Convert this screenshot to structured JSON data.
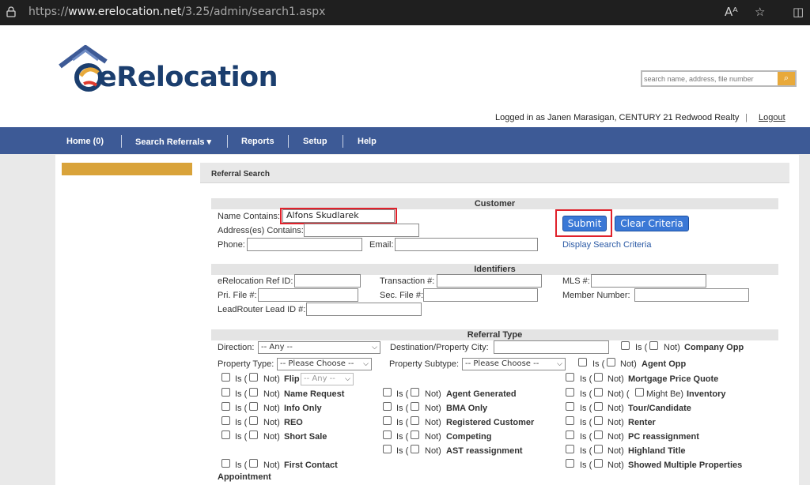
{
  "browser": {
    "url_scheme": "https://",
    "url_host": "www.erelocation.net",
    "url_path": "/3.25/admin/search1.aspx",
    "read_aloud_icon": "Aᴬ",
    "favorite_icon": "☆",
    "split_icon": "◫"
  },
  "header": {
    "logo_text": "eRelocation",
    "search_placeholder": "search name, address, file number",
    "logged_in_text": "Logged in as Janen Marasigan, CENTURY 21 Redwood Realty",
    "separator": "|",
    "logout_label": "Logout"
  },
  "nav": {
    "items": [
      "Home (0)",
      "Search Referrals ▾",
      "Reports",
      "Setup",
      "Help"
    ]
  },
  "page": {
    "section_title": "Referral Search",
    "customer": {
      "group_title": "Customer",
      "name_label": "Name Contains:",
      "name_value": "Alfons Skudlarek",
      "address_label": "Address(es) Contains:",
      "phone_label": "Phone:",
      "email_label": "Email:",
      "submit_label": "Submit",
      "clear_label": "Clear Criteria",
      "display_link": "Display Search Criteria"
    },
    "identifiers": {
      "group_title": "Identifiers",
      "ref_id_label": "eRelocation Ref ID:",
      "transaction_label": "Transaction #:",
      "mls_label": "MLS #:",
      "pri_file_label": "Pri. File #:",
      "sec_file_label": "Sec. File #:",
      "member_label": "Member Number:",
      "leadrouter_label": "LeadRouter Lead ID #:"
    },
    "referral_type": {
      "group_title": "Referral Type",
      "direction_label": "Direction:",
      "direction_value": "-- Any --",
      "dest_city_label": "Destination/Property City:",
      "property_type_label": "Property Type:",
      "property_type_value": "-- Please Choose --",
      "property_subtype_label": "Property Subtype:",
      "property_subtype_value": "-- Please Choose --",
      "flip_select_value": "-- Any --",
      "is_text": "Is (",
      "not_text": "Not)",
      "might_text": "Might Be)",
      "options": {
        "company_opp": "Company Opp",
        "agent_opp": "Agent Opp",
        "flip": "Flip",
        "mortgage_price_quote": "Mortgage Price Quote",
        "name_request": "Name Request",
        "agent_generated": "Agent Generated",
        "inventory": "Inventory",
        "info_only": "Info Only",
        "bma_only": "BMA Only",
        "tour_candidate": "Tour/Candidate",
        "reo": "REO",
        "registered_customer": "Registered Customer",
        "renter": "Renter",
        "short_sale": "Short Sale",
        "competing": "Competing",
        "pc_reassignment": "PC reassignment",
        "ast_reassignment": "AST reassignment",
        "highland_title": "Highland Title",
        "first_contact": "First Contact",
        "appointment": "Appointment",
        "showed_multiple": "Showed Multiple Properties"
      }
    }
  }
}
